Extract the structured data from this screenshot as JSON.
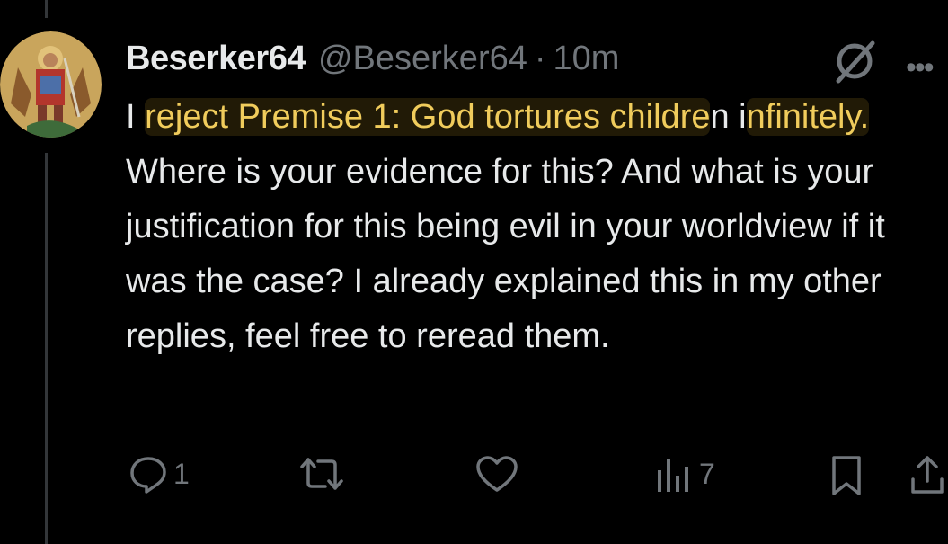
{
  "tweet": {
    "display_name": "Beserker64",
    "handle": "@Beserker64",
    "separator": "·",
    "time": "10m",
    "text_prefix": "I ",
    "text_highlight_1": "reject Premise 1: God tortures childre",
    "text_mid": "n i",
    "text_highlight_2": "nfinitely.",
    "text_rest": " Where is your evidence for this? And what is your justification for this being evil in your worldview if it was the case? I already explained this in my other replies, feel free to reread them.",
    "highlight_color": "#f0cc5c"
  },
  "actions": {
    "reply_count": "1",
    "views_count": "7"
  },
  "icons": [
    "avatar-icon",
    "grok-icon",
    "more-icon",
    "reply-icon",
    "retweet-icon",
    "like-icon",
    "views-icon",
    "bookmark-icon",
    "share-icon"
  ]
}
